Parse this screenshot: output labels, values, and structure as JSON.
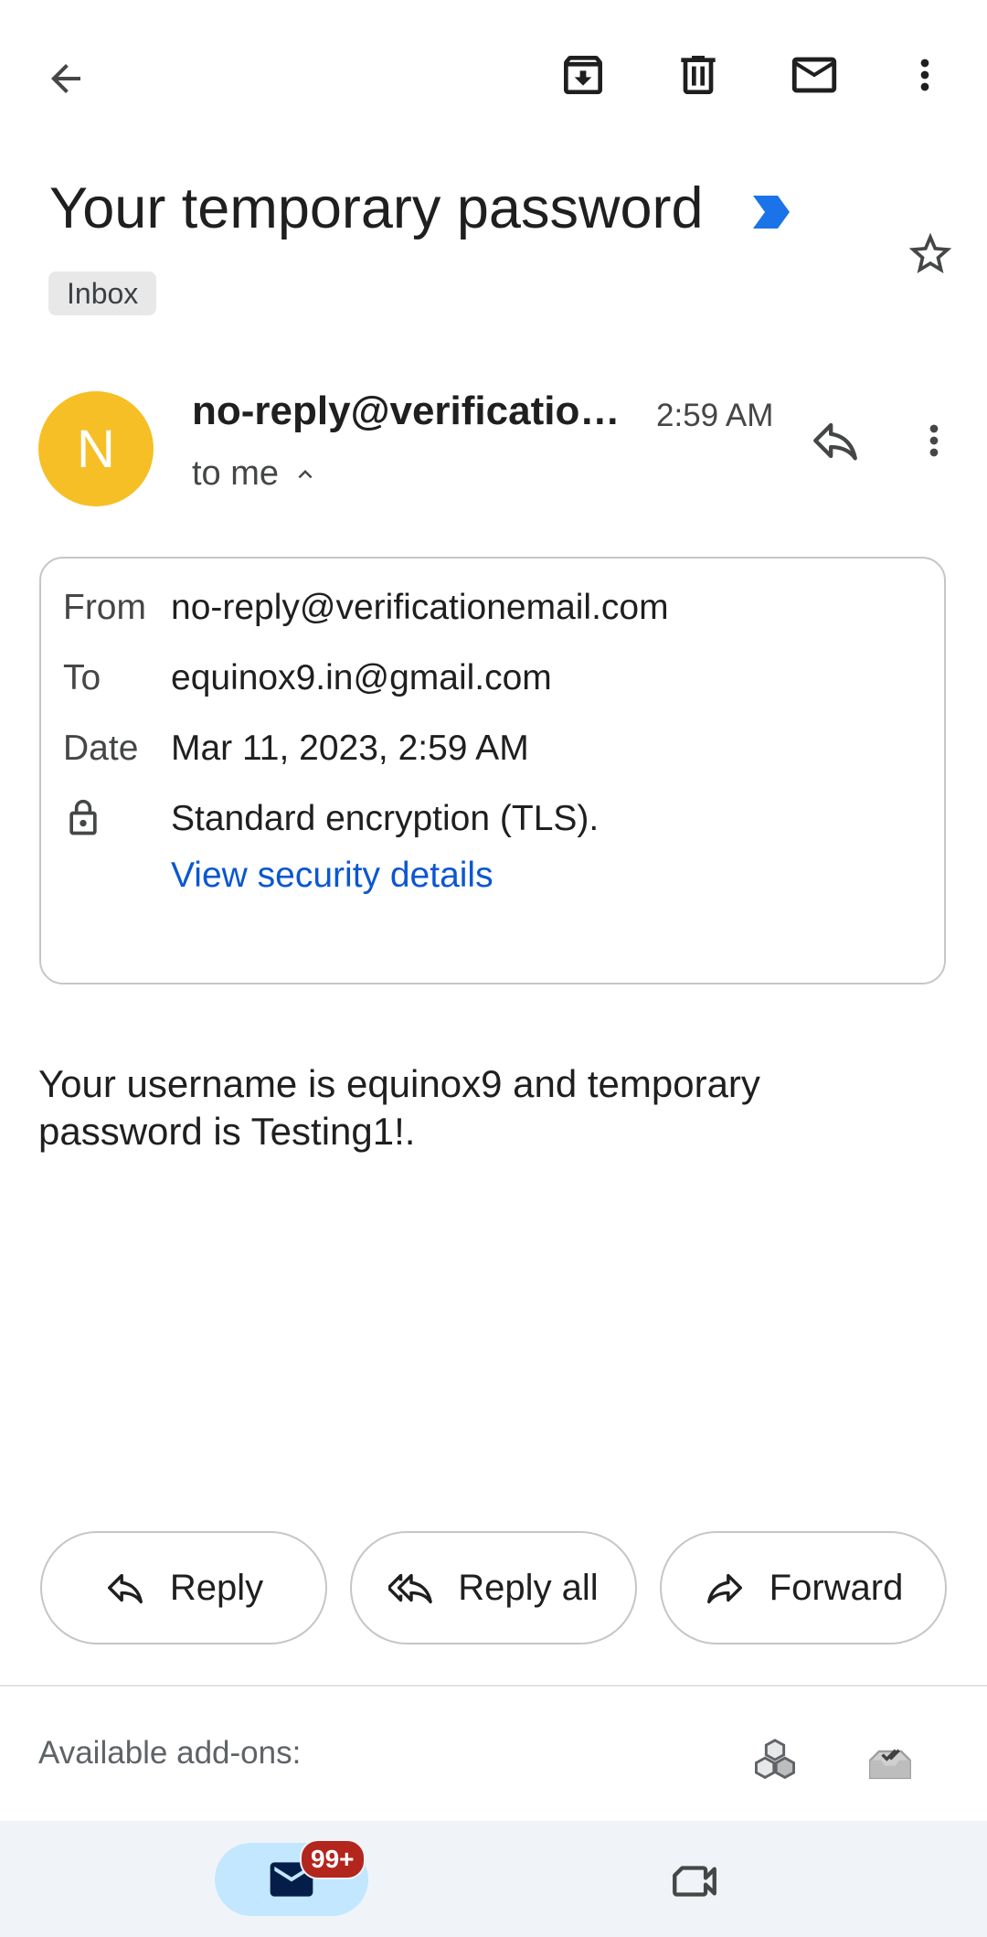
{
  "toolbar": {
    "back": "back-icon",
    "archive": "archive-icon",
    "delete": "delete-icon",
    "mark_unread": "mail-icon",
    "more": "more-vert-icon"
  },
  "email": {
    "subject": "Your temporary password",
    "label": "Inbox",
    "importance_color": "#1a73e8",
    "sender_initial": "N",
    "avatar_color": "#f6bf26",
    "sender_display": "no-reply@verificatio…",
    "time": "2:59 AM",
    "recipient_summary": "to me",
    "details": {
      "from_label": "From",
      "from_value": "no-reply@verificationemail.com",
      "to_label": "To",
      "to_value": "equinox9.in@gmail.com",
      "date_label": "Date",
      "date_value": "Mar 11, 2023, 2:59 AM",
      "encryption_text": "Standard encryption (TLS).",
      "security_link": "View security details"
    },
    "body_line1": "Your username is equinox9 and temporary",
    "body_line2": "password is Testing1!."
  },
  "actions": {
    "reply": "Reply",
    "reply_all": "Reply all",
    "forward": "Forward"
  },
  "addons": {
    "label": "Available add-ons:"
  },
  "bottom_nav": {
    "mail_badge": "99+"
  }
}
